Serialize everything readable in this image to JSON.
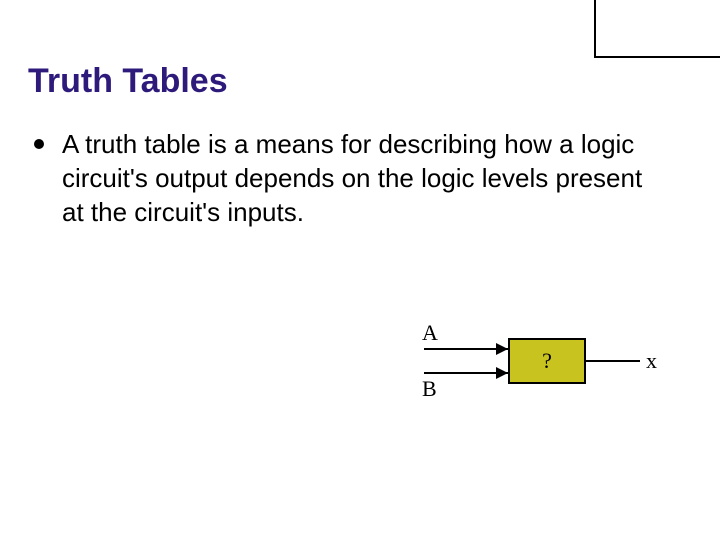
{
  "title": "Truth Tables",
  "bullet_text": "A truth table is a means for describing how a logic circuit's output depends on the logic levels present at the circuit's inputs.",
  "diagram": {
    "input_a": "A",
    "input_b": "B",
    "gate_label": "?",
    "output": "x"
  }
}
